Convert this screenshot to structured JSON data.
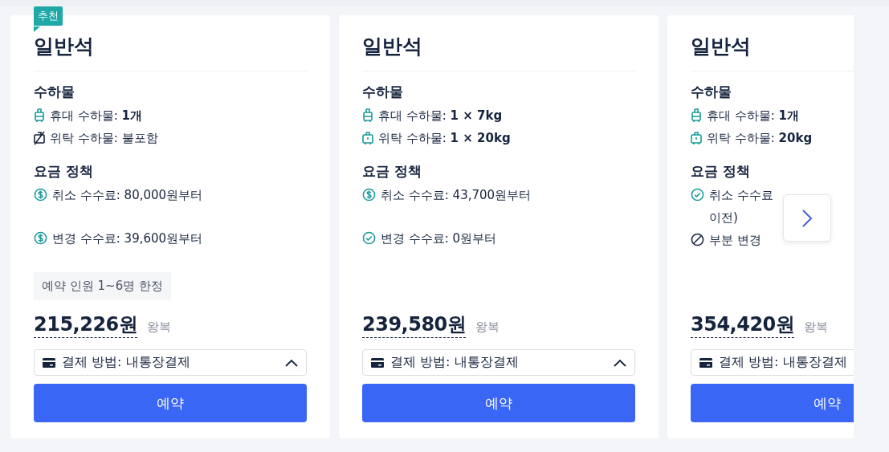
{
  "cards": [
    {
      "badge": "추천",
      "title": "일반석",
      "baggage_heading": "수하물",
      "baggage": [
        {
          "kind": "carry",
          "label": "휴대 수하물: ",
          "value": "1개"
        },
        {
          "kind": "none",
          "label": "위탁 수하물: 불포함"
        }
      ],
      "policy_heading": "요금 정책",
      "policies": [
        {
          "kind": "fee",
          "text": "취소 수수료: 80,000원부터"
        },
        {
          "kind": "fee",
          "text": "변경 수수료: 39,600원부터"
        }
      ],
      "note": "예약 인원 1~6명 한정",
      "price": "215,226원",
      "trip": "왕복",
      "payment": "결제 방법: 내통장결제",
      "expanded": true,
      "book": "예약"
    },
    {
      "title": "일반석",
      "baggage_heading": "수하물",
      "baggage": [
        {
          "kind": "carry",
          "label": "휴대 수하물: ",
          "value": "1 × 7kg"
        },
        {
          "kind": "checked",
          "label": "위탁 수하물: ",
          "value": "1 × 20kg"
        }
      ],
      "policy_heading": "요금 정책",
      "policies": [
        {
          "kind": "fee",
          "text": "취소 수수료: 43,700원부터"
        },
        {
          "kind": "free",
          "text": "변경 수수료: 0원부터"
        }
      ],
      "price": "239,580원",
      "trip": "왕복",
      "payment": "결제 방법: 내통장결제",
      "expanded": true,
      "book": "예약"
    },
    {
      "title": "일반석",
      "baggage_heading": "수하물",
      "baggage": [
        {
          "kind": "carry",
          "label": "휴대 수하물: ",
          "value": "1개"
        },
        {
          "kind": "checked",
          "label": "위탁 수하물: ",
          "value": "20kg"
        }
      ],
      "policy_heading": "요금 정책",
      "policies": [
        {
          "kind": "free",
          "text": "취소 수수료",
          "more": "이전)"
        },
        {
          "kind": "partial",
          "text": "부분 변경"
        }
      ],
      "price": "354,420원",
      "trip": "왕복",
      "payment": "결제 방법: 내통장결제",
      "book": "예약"
    }
  ]
}
